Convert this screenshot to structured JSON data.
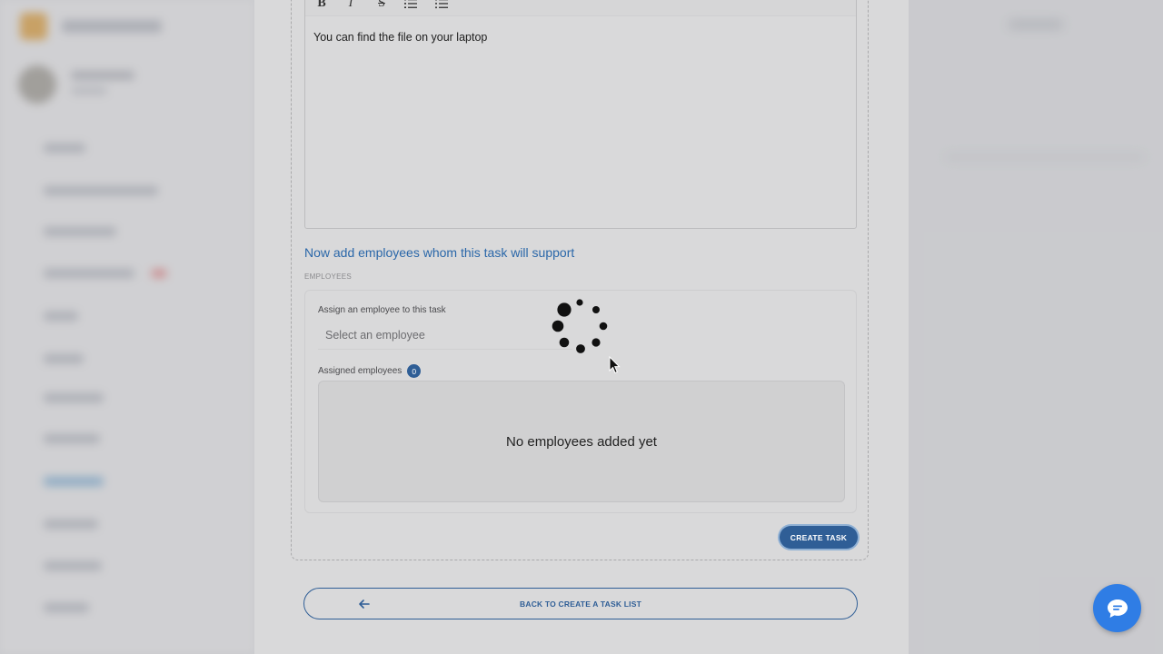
{
  "editor": {
    "toolbar": {
      "bold_icon": "B",
      "italic_icon": "I",
      "strike_icon": "S",
      "ordered_list_icon": "ordered-list-icon",
      "bullet_list_icon": "bullet-list-icon"
    },
    "content": "You can find the file on your laptop"
  },
  "employees_section": {
    "title": "Now add employees whom this task will support",
    "subtitle": "EMPLOYEES",
    "assign_label": "Assign an employee to this task",
    "select_placeholder": "Select an employee",
    "assigned_label": "Assigned employees",
    "assigned_count": "0",
    "empty_message": "No employees added yet"
  },
  "actions": {
    "create_task": "CREATE TASK",
    "back": "BACK TO CREATE A TASK LIST"
  },
  "colors": {
    "accent": "#2f5e96",
    "title_blue": "#2a67a9",
    "chat_blue": "#2f7de5"
  }
}
